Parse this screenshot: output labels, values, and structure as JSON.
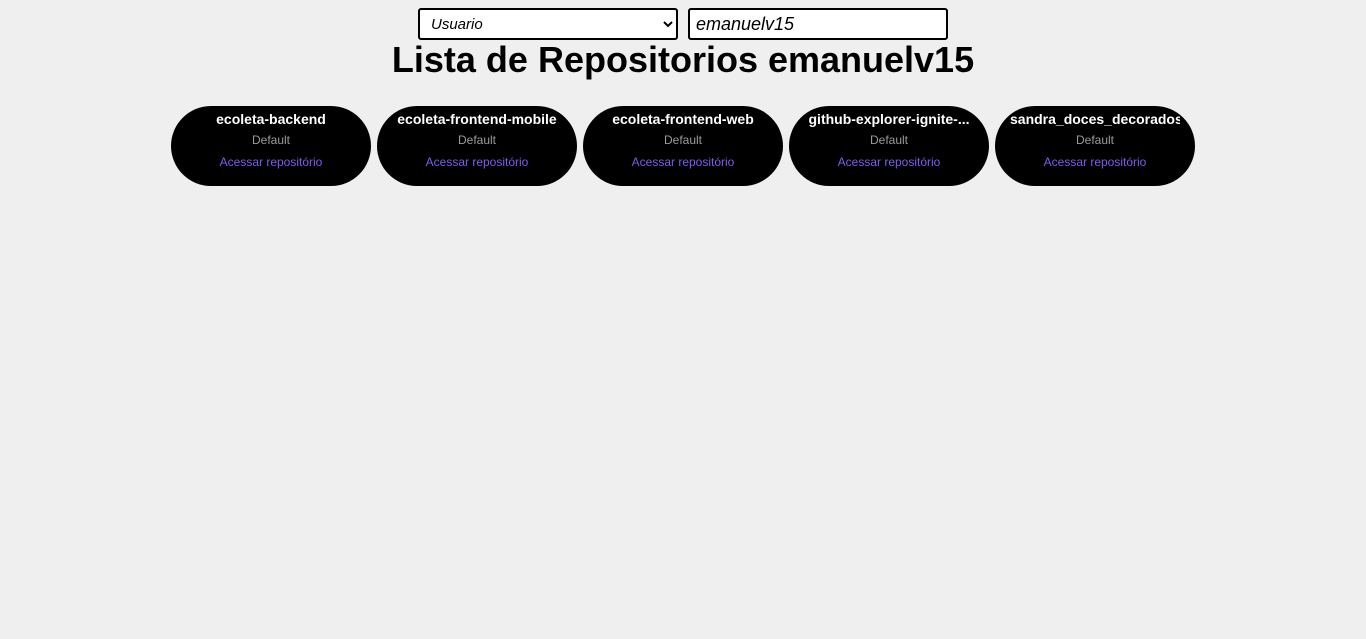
{
  "search": {
    "type_selected": "Usuario",
    "type_options": [
      "Usuario"
    ],
    "query_value": "emanuelv15"
  },
  "title": "Lista de Repositorios emanuelv15",
  "repos": [
    {
      "name": "ecoleta-backend",
      "language": "Default",
      "link_label": "Acessar repositório"
    },
    {
      "name": "ecoleta-frontend-mobile",
      "language": "Default",
      "link_label": "Acessar repositório"
    },
    {
      "name": "ecoleta-frontend-web",
      "language": "Default",
      "link_label": "Acessar repositório"
    },
    {
      "name": "github-explorer-ignite-...",
      "language": "Default",
      "link_label": "Acessar repositório"
    },
    {
      "name": "sandra_doces_decorados",
      "language": "Default",
      "link_label": "Acessar repositório"
    }
  ],
  "colors": {
    "background": "#efefef",
    "card": "#000000",
    "card_title": "#ffffff",
    "language_text": "#9a9a9a",
    "link": "#7b5cf0"
  }
}
